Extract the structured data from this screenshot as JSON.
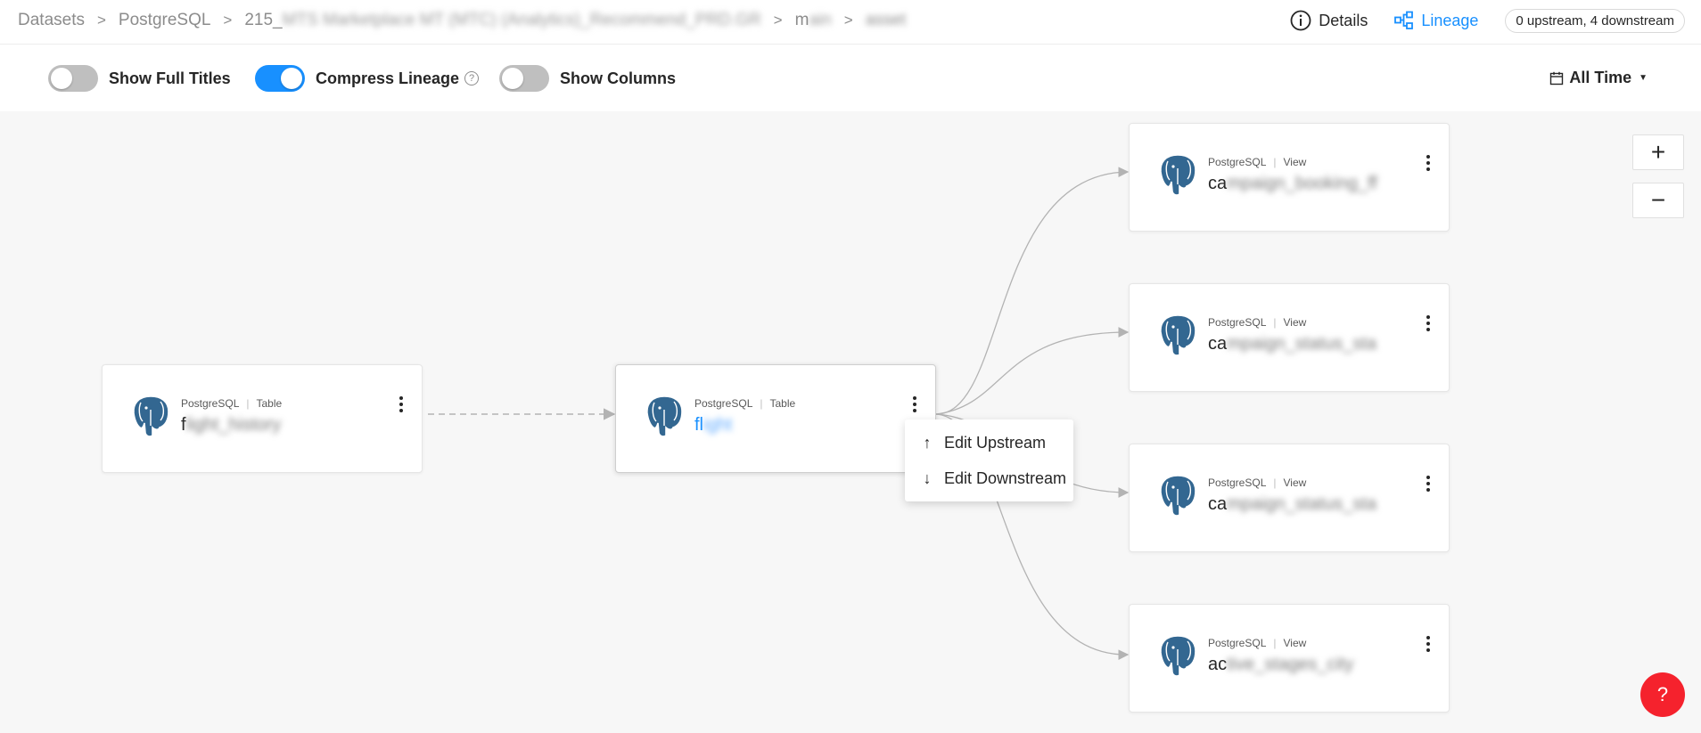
{
  "breadcrumb": {
    "items": [
      "Datasets",
      "PostgreSQL",
      "215_",
      "m"
    ],
    "separator": ">",
    "blurred_hint_1": "MTS Marketplace MT (MTC) (Analytics)_Recommend_PRD.GR",
    "blurred_hint_2": "ain",
    "blurred_hint_3": "asset"
  },
  "header": {
    "details_label": "Details",
    "lineage_label": "Lineage",
    "count_label": "0 upstream, 4 downstream",
    "accent_color": "#1890ff"
  },
  "controls": {
    "show_full_titles": {
      "label": "Show Full Titles",
      "on": false
    },
    "compress_lineage": {
      "label": "Compress Lineage",
      "on": true,
      "help": "?"
    },
    "show_columns": {
      "label": "Show Columns",
      "on": false
    },
    "time_filter": "All Time"
  },
  "nodes": {
    "upstream": {
      "platform": "PostgreSQL",
      "subtype": "Table",
      "title_prefix": "f",
      "title_blur": "light_history"
    },
    "center": {
      "platform": "PostgreSQL",
      "subtype": "Table",
      "title_prefix": "fl",
      "title_blur": "ight"
    },
    "down1": {
      "platform": "PostgreSQL",
      "subtype": "View",
      "title_prefix": "ca",
      "title_blur": "mpaign_booking_ff"
    },
    "down2": {
      "platform": "PostgreSQL",
      "subtype": "View",
      "title_prefix": "ca",
      "title_blur": "mpaign_status_sta"
    },
    "down3": {
      "platform": "PostgreSQL",
      "subtype": "View",
      "title_prefix": "ca",
      "title_blur": "mpaign_status_sta"
    },
    "down4": {
      "platform": "PostgreSQL",
      "subtype": "View",
      "title_prefix": "ac",
      "title_blur": "tive_stages_city"
    }
  },
  "menu": {
    "edit_upstream": "Edit Upstream",
    "edit_downstream": "Edit Downstream",
    "up_arrow": "↑",
    "down_arrow": "↓"
  },
  "zoom": {
    "in": "+",
    "out": "−"
  },
  "help_fab": "?"
}
